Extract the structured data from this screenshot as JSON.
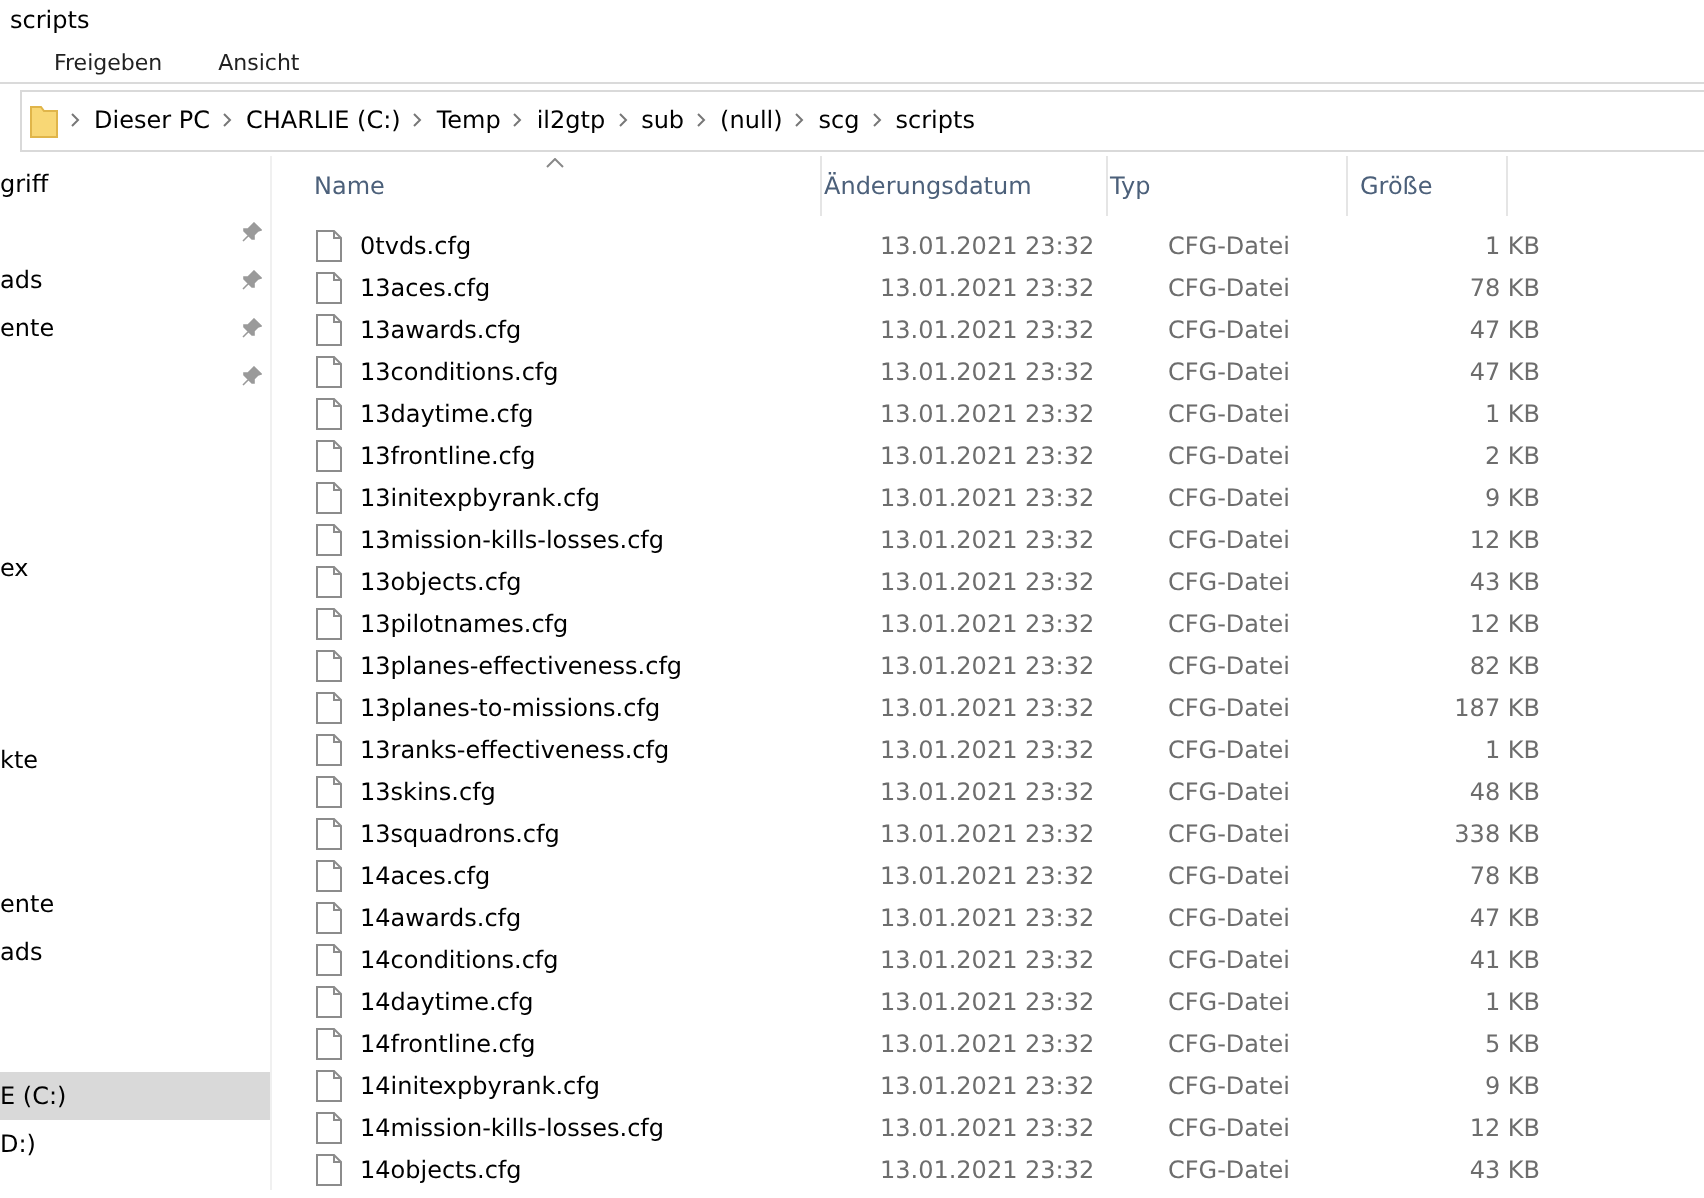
{
  "window": {
    "title": "scripts"
  },
  "ribbon_tabs": [
    {
      "label": "Freigeben",
      "selected": false
    },
    {
      "label": "Ansicht",
      "selected": false
    }
  ],
  "address_bar": {
    "path": [
      "Dieser PC",
      "CHARLIE (C:)",
      "Temp",
      "il2gtp",
      "sub",
      "(null)",
      "scg",
      "scripts"
    ]
  },
  "sidebar": {
    "items": [
      {
        "kind": "item",
        "label": "griff",
        "pinned": false,
        "selected": false
      },
      {
        "kind": "item",
        "pinned": true,
        "selected": false
      },
      {
        "kind": "item",
        "label": "ads",
        "pinned": true,
        "selected": false
      },
      {
        "kind": "item",
        "label": "ente",
        "pinned": true,
        "selected": false
      },
      {
        "kind": "item",
        "pinned": true,
        "selected": false
      },
      {
        "kind": "spacer"
      },
      {
        "kind": "spacer"
      },
      {
        "kind": "spacer"
      },
      {
        "kind": "item",
        "label": "ex",
        "pinned": false,
        "selected": false
      },
      {
        "kind": "spacer"
      },
      {
        "kind": "spacer"
      },
      {
        "kind": "spacer"
      },
      {
        "kind": "item",
        "label": "kte",
        "pinned": false,
        "selected": false
      },
      {
        "kind": "spacer"
      },
      {
        "kind": "spacer"
      },
      {
        "kind": "item",
        "label": "ente",
        "pinned": false,
        "selected": false
      },
      {
        "kind": "item",
        "label": "ads",
        "pinned": false,
        "selected": false
      },
      {
        "kind": "spacer"
      },
      {
        "kind": "spacer"
      },
      {
        "kind": "item",
        "label": "E (C:)",
        "pinned": false,
        "selected": true
      },
      {
        "kind": "item",
        "label": "D:)",
        "pinned": false,
        "selected": false
      }
    ]
  },
  "file_list": {
    "columns": [
      "Name",
      "Änderungsdatum",
      "Typ",
      "Größe"
    ],
    "rows": [
      {
        "name": "0tvds.cfg",
        "date": "13.01.2021 23:32",
        "type": "CFG-Datei",
        "size": "1 KB"
      },
      {
        "name": "13aces.cfg",
        "date": "13.01.2021 23:32",
        "type": "CFG-Datei",
        "size": "78 KB"
      },
      {
        "name": "13awards.cfg",
        "date": "13.01.2021 23:32",
        "type": "CFG-Datei",
        "size": "47 KB"
      },
      {
        "name": "13conditions.cfg",
        "date": "13.01.2021 23:32",
        "type": "CFG-Datei",
        "size": "47 KB"
      },
      {
        "name": "13daytime.cfg",
        "date": "13.01.2021 23:32",
        "type": "CFG-Datei",
        "size": "1 KB"
      },
      {
        "name": "13frontline.cfg",
        "date": "13.01.2021 23:32",
        "type": "CFG-Datei",
        "size": "2 KB"
      },
      {
        "name": "13initexpbyrank.cfg",
        "date": "13.01.2021 23:32",
        "type": "CFG-Datei",
        "size": "9 KB"
      },
      {
        "name": "13mission-kills-losses.cfg",
        "date": "13.01.2021 23:32",
        "type": "CFG-Datei",
        "size": "12 KB"
      },
      {
        "name": "13objects.cfg",
        "date": "13.01.2021 23:32",
        "type": "CFG-Datei",
        "size": "43 KB"
      },
      {
        "name": "13pilotnames.cfg",
        "date": "13.01.2021 23:32",
        "type": "CFG-Datei",
        "size": "12 KB"
      },
      {
        "name": "13planes-effectiveness.cfg",
        "date": "13.01.2021 23:32",
        "type": "CFG-Datei",
        "size": "82 KB"
      },
      {
        "name": "13planes-to-missions.cfg",
        "date": "13.01.2021 23:32",
        "type": "CFG-Datei",
        "size": "187 KB"
      },
      {
        "name": "13ranks-effectiveness.cfg",
        "date": "13.01.2021 23:32",
        "type": "CFG-Datei",
        "size": "1 KB"
      },
      {
        "name": "13skins.cfg",
        "date": "13.01.2021 23:32",
        "type": "CFG-Datei",
        "size": "48 KB"
      },
      {
        "name": "13squadrons.cfg",
        "date": "13.01.2021 23:32",
        "type": "CFG-Datei",
        "size": "338 KB"
      },
      {
        "name": "14aces.cfg",
        "date": "13.01.2021 23:32",
        "type": "CFG-Datei",
        "size": "78 KB"
      },
      {
        "name": "14awards.cfg",
        "date": "13.01.2021 23:32",
        "type": "CFG-Datei",
        "size": "47 KB"
      },
      {
        "name": "14conditions.cfg",
        "date": "13.01.2021 23:32",
        "type": "CFG-Datei",
        "size": "41 KB"
      },
      {
        "name": "14daytime.cfg",
        "date": "13.01.2021 23:32",
        "type": "CFG-Datei",
        "size": "1 KB"
      },
      {
        "name": "14frontline.cfg",
        "date": "13.01.2021 23:32",
        "type": "CFG-Datei",
        "size": "5 KB"
      },
      {
        "name": "14initexpbyrank.cfg",
        "date": "13.01.2021 23:32",
        "type": "CFG-Datei",
        "size": "9 KB"
      },
      {
        "name": "14mission-kills-losses.cfg",
        "date": "13.01.2021 23:32",
        "type": "CFG-Datei",
        "size": "12 KB"
      },
      {
        "name": "14objects.cfg",
        "date": "13.01.2021 23:32",
        "type": "CFG-Datei",
        "size": "43 KB"
      }
    ]
  }
}
